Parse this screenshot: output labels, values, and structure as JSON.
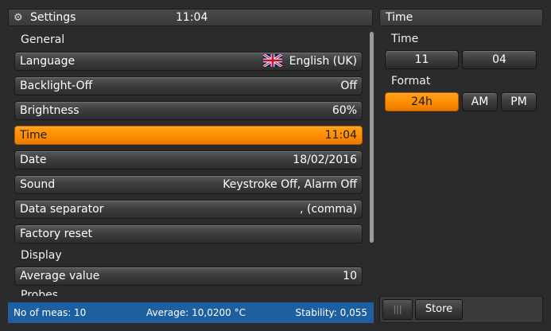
{
  "header": {
    "icon": "gear-icon",
    "title": "Settings",
    "clock": "11:04"
  },
  "settings": {
    "general_label": "General",
    "display_label": "Display",
    "probes_label": "Probes",
    "rows": [
      {
        "label": "Language",
        "value": "English (UK)",
        "icon": "uk-flag-icon"
      },
      {
        "label": "Backlight-Off",
        "value": "Off"
      },
      {
        "label": "Brightness",
        "value": "60%"
      },
      {
        "label": "Time",
        "value": "11:04",
        "active": true
      },
      {
        "label": "Date",
        "value": "18/02/2016"
      },
      {
        "label": "Sound",
        "value": "Keystroke Off, Alarm Off"
      },
      {
        "label": "Data separator",
        "value": ", (comma)"
      },
      {
        "label": "Factory reset",
        "value": ""
      }
    ],
    "display_rows": [
      {
        "label": "Average value",
        "value": "10"
      }
    ]
  },
  "time_panel": {
    "title": "Time",
    "time_label": "Time",
    "hour": "11",
    "minute": "04",
    "format_label": "Format",
    "formats": [
      "24h",
      "AM",
      "PM"
    ],
    "selected_format": "24h"
  },
  "status": {
    "meas": "No of meas: 10",
    "average": "Average: 10,0200 °C",
    "stability": "Stability: 0,055"
  },
  "bottom": {
    "store_label": "Store",
    "handle_icon": "grip-icon"
  },
  "colors": {
    "accent": "#ff8c00",
    "status_bar": "#1e5fa0",
    "background": "#2b2b2b"
  }
}
